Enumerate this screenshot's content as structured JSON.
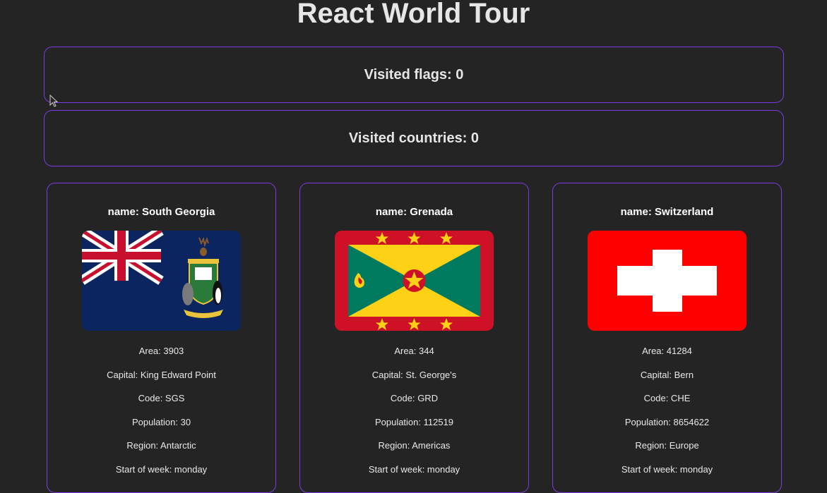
{
  "page": {
    "title": "React World Tour"
  },
  "counters": {
    "visited_flags": "Visited flags: 0",
    "visited_countries": "Visited countries: 0"
  },
  "countries": [
    {
      "name": "name: South Georgia",
      "flag_icon": "south-georgia-flag",
      "area": "Area: 3903",
      "capital": "Capital: King Edward Point",
      "code": "Code: SGS",
      "population": "Population: 30",
      "region": "Region: Antarctic",
      "start_of_week": "Start of week: monday"
    },
    {
      "name": "name: Grenada",
      "flag_icon": "grenada-flag",
      "area": "Area: 344",
      "capital": "Capital: St. George's",
      "code": "Code: GRD",
      "population": "Population: 112519",
      "region": "Region: Americas",
      "start_of_week": "Start of week: monday"
    },
    {
      "name": "name: Switzerland",
      "flag_icon": "switzerland-flag",
      "area": "Area: 41284",
      "capital": "Capital: Bern",
      "code": "Code: CHE",
      "population": "Population: 8654622",
      "region": "Region: Europe",
      "start_of_week": "Start of week: monday"
    }
  ],
  "colors": {
    "background": "#242424",
    "accent_border": "#7c3ae0",
    "text": "#e6e6e6"
  }
}
